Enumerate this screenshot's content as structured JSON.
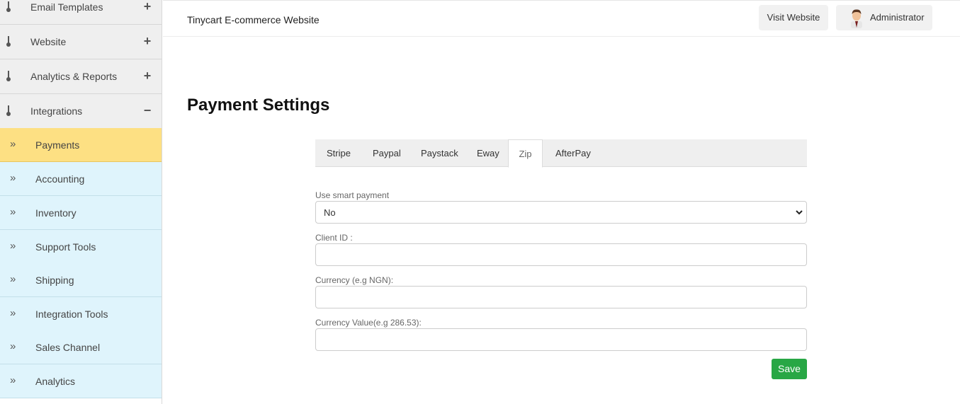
{
  "sidebar": {
    "sections": [
      {
        "label": "Email Templates",
        "toggle": "+"
      },
      {
        "label": "Website",
        "toggle": "+"
      },
      {
        "label": "Analytics & Reports",
        "toggle": "+"
      },
      {
        "label": "Integrations",
        "toggle": "−"
      }
    ],
    "items": [
      {
        "label": "Payments",
        "active": true
      },
      {
        "label": "Accounting"
      },
      {
        "label": "Inventory"
      },
      {
        "label": "Support Tools"
      },
      {
        "label": "Shipping"
      },
      {
        "label": "Integration Tools"
      },
      {
        "label": "Sales Channel"
      },
      {
        "label": "Analytics"
      }
    ],
    "chevron": "»"
  },
  "header": {
    "site_title": "Tinycart E-commerce Website",
    "visit_label": "Visit Website",
    "user_label": "Administrator"
  },
  "main": {
    "page_title": "Payment Settings",
    "tabs": [
      "Stripe",
      "Paypal",
      "Paystack",
      "Eway",
      "Zip",
      "AfterPay"
    ],
    "active_tab": "Zip",
    "form": {
      "smart_payment_label": "Use smart payment",
      "smart_payment_value": "No",
      "client_id_label": "Client ID :",
      "client_id_value": "",
      "currency_label": "Currency (e.g NGN):",
      "currency_value": "",
      "currency_value_label": "Currency Value(e.g 286.53):",
      "currency_value_value": ""
    },
    "save_label": "Save"
  },
  "colors": {
    "active_item_bg": "#fde083",
    "submenu_bg": "#dff4fc",
    "save_button": "#28a745"
  }
}
